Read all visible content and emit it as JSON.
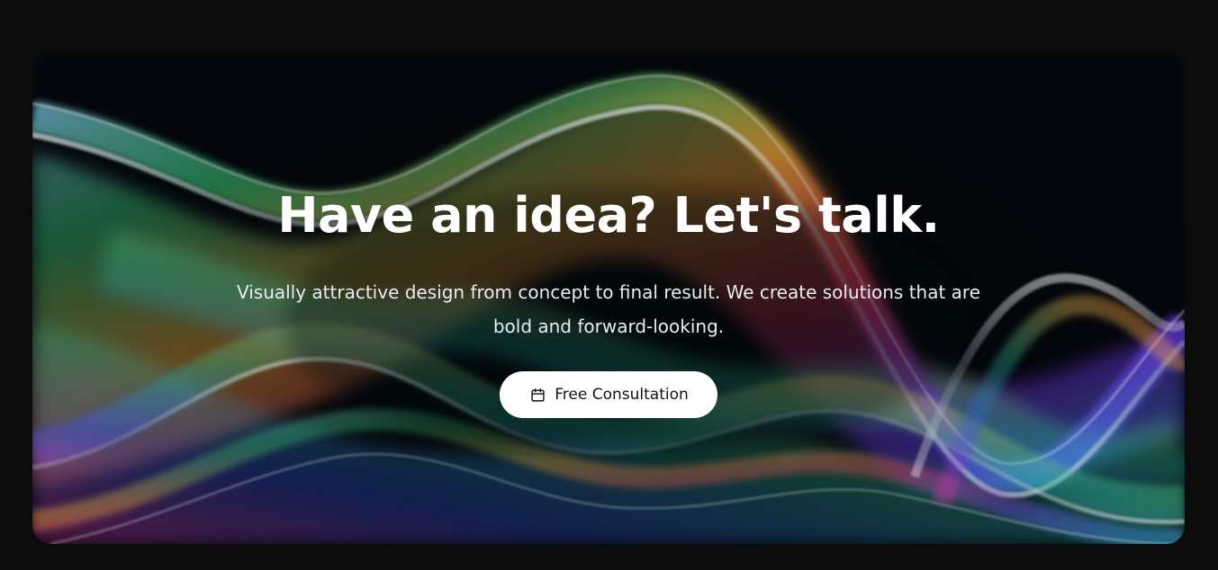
{
  "hero": {
    "headline": "Have an idea? Let's talk.",
    "subtext": "Visually attractive design from concept to final result. We create solutions that are bold and forward-looking.",
    "cta_label": "Free Consultation",
    "cta_icon": "calendar-icon"
  },
  "colors": {
    "page_background": "#0b0b0b",
    "hero_background": "#04070c",
    "headline_text": "#ffffff",
    "cta_background": "#ffffff",
    "cta_text": "#111111"
  }
}
